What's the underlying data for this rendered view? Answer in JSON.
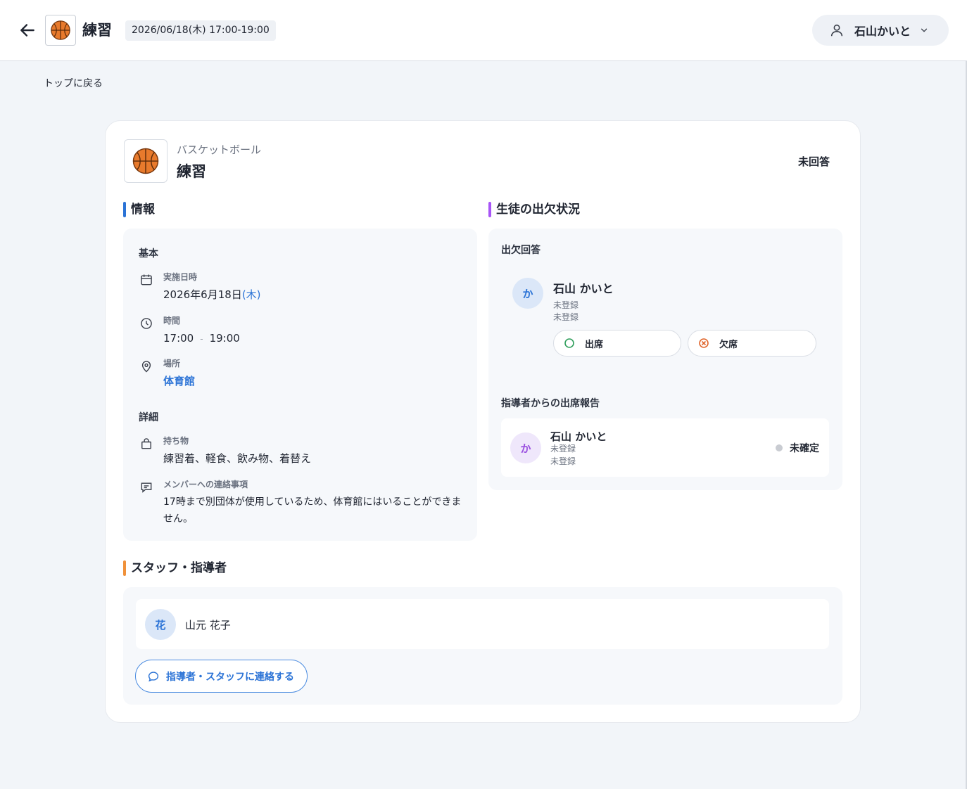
{
  "header": {
    "title": "練習",
    "datetime": "2026/06/18(木)  17:00-19:00",
    "user_name": "石山かいと"
  },
  "nav": {
    "back_to_top": "トップに戻る"
  },
  "event": {
    "category": "バスケットボール",
    "name": "練習",
    "response_status": "未回答",
    "icon": "basketball-icon"
  },
  "info_section": {
    "title": "情報",
    "basic_heading": "基本",
    "date_label": "実施日時",
    "date_value": "2026年6月18日",
    "date_weekday": "(木)",
    "time_label": "時間",
    "time_start": "17:00",
    "time_sep": "-",
    "time_end": "19:00",
    "place_label": "場所",
    "place_value": "体育館",
    "detail_heading": "詳細",
    "items_label": "持ち物",
    "items_value": "練習着、軽食、飲み物、着替え",
    "notes_label": "メンバーへの連絡事項",
    "notes_value": "17時まで別団体が使用しているため、体育館にはいることができません。"
  },
  "attendance_section": {
    "title": "生徒の出欠状況",
    "response_heading": "出欠回答",
    "student_initial": "か",
    "student_name": "石山 かいと",
    "student_sub1": "未登録",
    "student_sub2": "未登録",
    "attend_label": "出席",
    "absent_label": "欠席",
    "report_heading": "指導者からの出席報告",
    "report_initial": "か",
    "report_name": "石山 かいと",
    "report_sub1": "未登録",
    "report_sub2": "未登録",
    "report_status": "未確定"
  },
  "staff_section": {
    "title": "スタッフ・指導者",
    "staff_initial": "花",
    "staff_name": "山元 花子",
    "contact_label": "指導者・スタッフに連絡する"
  },
  "colors": {
    "accent_blue": "#2b73d6",
    "bar_info": "#2b73d6",
    "bar_attendance": "#a855f7",
    "bar_staff": "#f0913a",
    "attend_green": "#2f9e5b",
    "absent_orange": "#e0652b"
  }
}
